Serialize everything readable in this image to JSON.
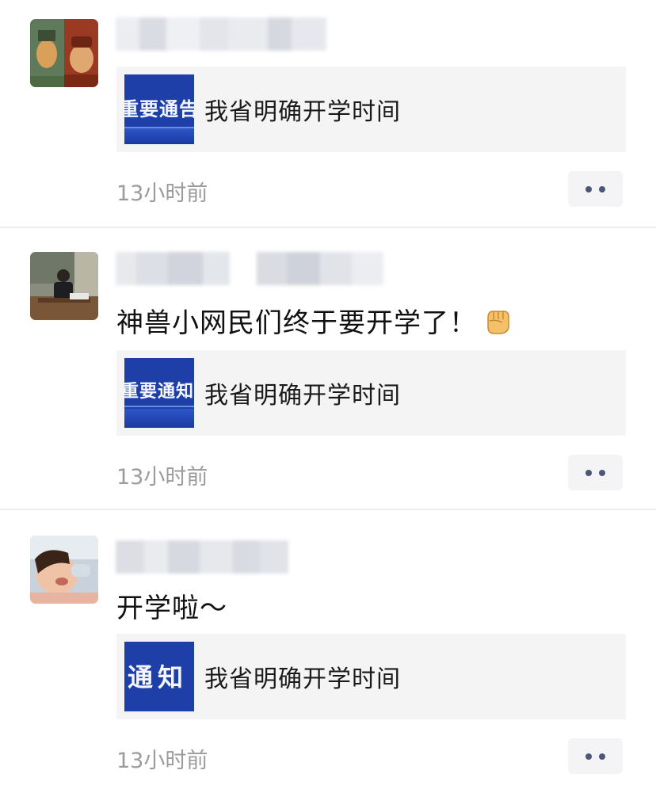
{
  "posts": [
    {
      "id": "post-1",
      "avatar": "avatar-two-portraits",
      "text": "",
      "link": {
        "thumb_text": "重要通告",
        "title": "我省明确开学时间"
      },
      "time": "13小时前"
    },
    {
      "id": "post-2",
      "avatar": "avatar-person-at-desk",
      "text": "神兽小网民们终于要开学了！",
      "emoji": "raised-fist-emoji",
      "link": {
        "thumb_text": "重要通知",
        "title": "我省明确开学时间"
      },
      "time": "13小时前"
    },
    {
      "id": "post-3",
      "avatar": "avatar-child-drinking",
      "text": "开学啦～",
      "link": {
        "thumb_text": "通知",
        "title": "我省明确开学时间"
      },
      "time": "13小时前"
    }
  ],
  "colors": {
    "thumb_blue": "#1e3fa8",
    "card_bg": "#f4f4f4",
    "time_gray": "#9b9b9b",
    "more_dots": "#4a5876"
  }
}
